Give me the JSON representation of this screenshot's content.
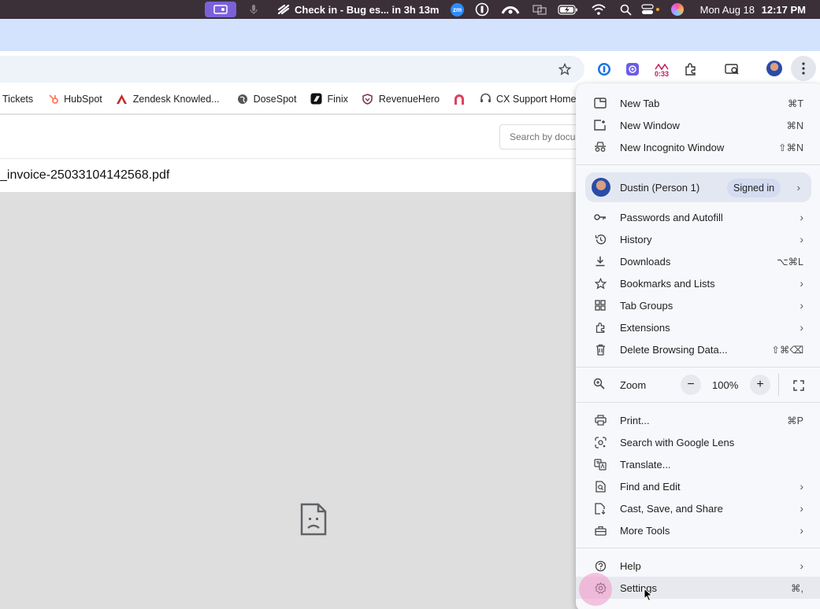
{
  "menubar": {
    "meeting_text": "Check in - Bug es... in 3h 13m",
    "zoom_badge": "zm",
    "date": "Mon Aug 18",
    "time": "12:17 PM"
  },
  "toolbar": {
    "extension_timer": "0:33"
  },
  "bookmarks": [
    {
      "label": "Tickets",
      "icon": "bookmark-icon"
    },
    {
      "label": "HubSpot",
      "icon": "hubspot-icon"
    },
    {
      "label": "Zendesk Knowled...",
      "icon": "zendesk-icon"
    },
    {
      "label": "DoseSpot",
      "icon": "globe-icon"
    },
    {
      "label": "Finix",
      "icon": "finix-icon"
    },
    {
      "label": "RevenueHero",
      "icon": "shield-icon"
    },
    {
      "label": "",
      "icon": "arch-icon"
    },
    {
      "label": "CX Support Home",
      "icon": "headset-icon"
    }
  ],
  "page": {
    "search_placeholder": "Search by docu",
    "filename": "_invoice-25033104142568.pdf"
  },
  "menu": {
    "new_tab": {
      "label": "New Tab",
      "shortcut": "⌘T"
    },
    "new_window": {
      "label": "New Window",
      "shortcut": "⌘N"
    },
    "incognito": {
      "label": "New Incognito Window",
      "shortcut": "⇧⌘N"
    },
    "profile": {
      "name": "Dustin (Person 1)",
      "status": "Signed in"
    },
    "passwords": {
      "label": "Passwords and Autofill"
    },
    "history": {
      "label": "History"
    },
    "downloads": {
      "label": "Downloads",
      "shortcut": "⌥⌘L"
    },
    "bookmarks": {
      "label": "Bookmarks and Lists"
    },
    "tab_groups": {
      "label": "Tab Groups"
    },
    "extensions": {
      "label": "Extensions"
    },
    "delete_data": {
      "label": "Delete Browsing Data...",
      "shortcut": "⇧⌘⌫"
    },
    "zoom": {
      "label": "Zoom",
      "minus": "−",
      "value": "100%",
      "plus": "+"
    },
    "print": {
      "label": "Print...",
      "shortcut": "⌘P"
    },
    "lens": {
      "label": "Search with Google Lens"
    },
    "translate": {
      "label": "Translate..."
    },
    "find_edit": {
      "label": "Find and Edit"
    },
    "cast_save": {
      "label": "Cast, Save, and Share"
    },
    "more_tools": {
      "label": "More Tools"
    },
    "help": {
      "label": "Help"
    },
    "settings": {
      "label": "Settings",
      "shortcut": "⌘,"
    }
  },
  "colors": {
    "tabstrip": "#d3e3fd",
    "menu_bg": "#f7f8fb",
    "profile_bg": "#e3e7f1",
    "macos_bar": "#3b3038",
    "screen_share": "#7b61d9"
  }
}
